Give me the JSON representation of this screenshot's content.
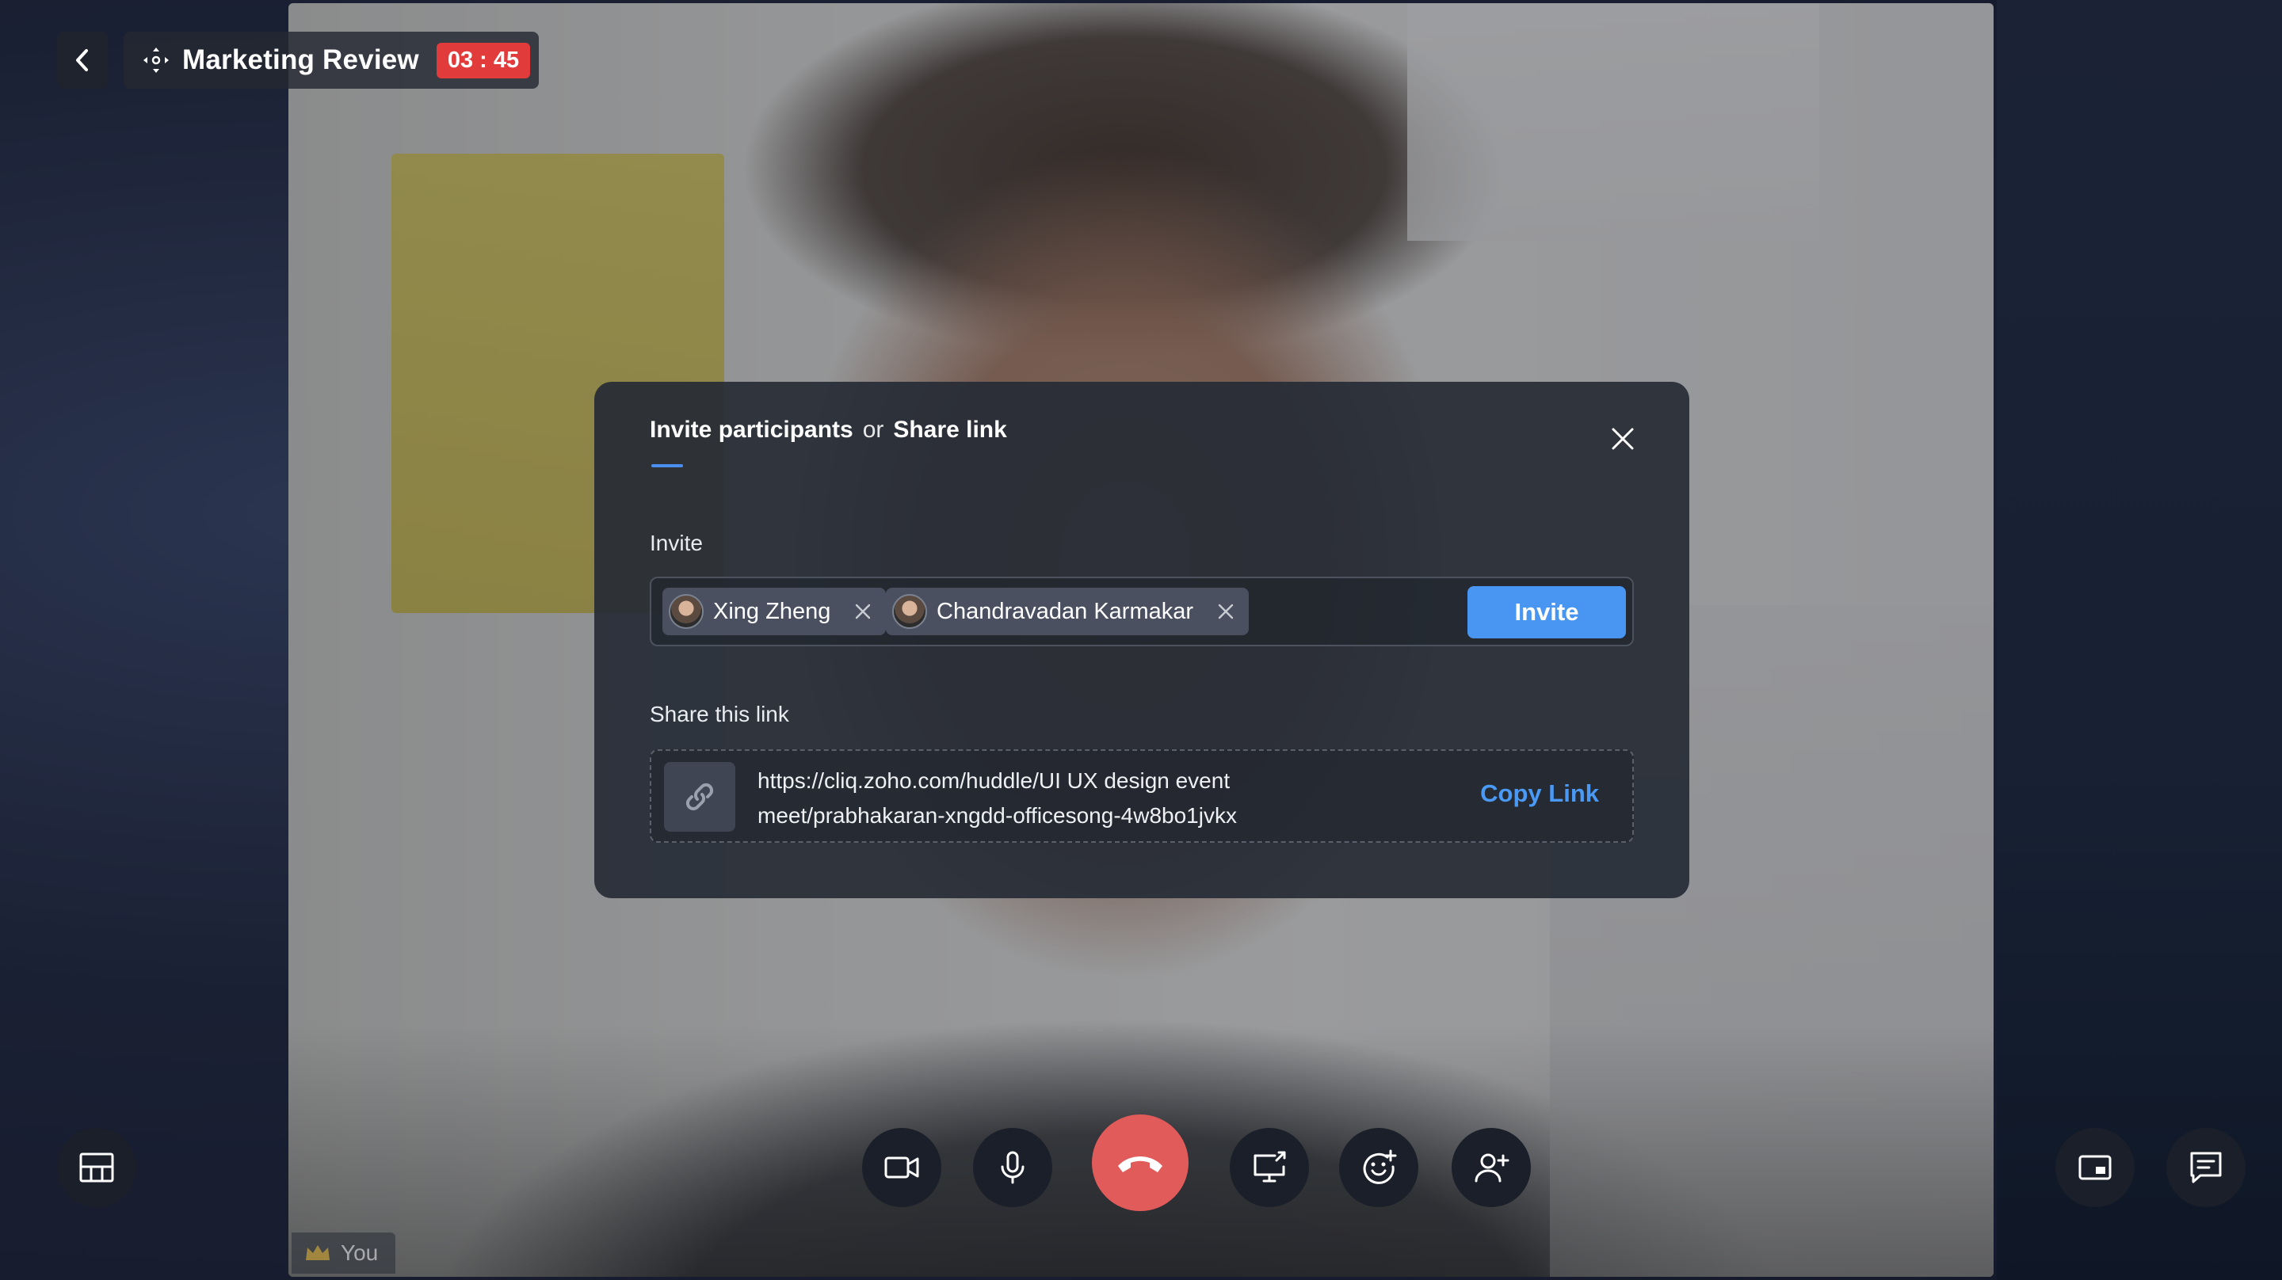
{
  "meeting": {
    "title": "Marketing Review",
    "timer": "03 : 45"
  },
  "icons": {
    "back": "chevron-left-icon",
    "meeting": "meeting-drag-icon",
    "close": "close-icon",
    "link": "link-icon",
    "layout": "layout-grid-icon",
    "video": "video-camera-icon",
    "mic": "microphone-icon",
    "end_call": "phone-hangup-icon",
    "screen_share": "screen-share-icon",
    "reaction": "emoji-reaction-icon",
    "add_participant": "add-user-icon",
    "pip": "picture-in-picture-icon",
    "chat": "chat-icon",
    "crown": "crown-icon"
  },
  "dialog": {
    "tab_invite": "Invite participants",
    "or": "or",
    "tab_share": "Share link",
    "invite_label": "Invite",
    "invitees": [
      {
        "name": "Xing Zheng"
      },
      {
        "name": "Chandravadan Karmakar"
      }
    ],
    "invite_button": "Invite",
    "share_label": "Share this link",
    "link_line1": "https://cliq.zoho.com/huddle/UI UX design event",
    "link_line2": "meet/prabhakaran-xngdd-officesong-4w8bo1jvkx",
    "copy_link": "Copy Link"
  },
  "self_tile": {
    "label": "You"
  },
  "colors": {
    "accent": "#4896f2",
    "end_call": "#e25b5b",
    "timer": "#e23b3b"
  }
}
